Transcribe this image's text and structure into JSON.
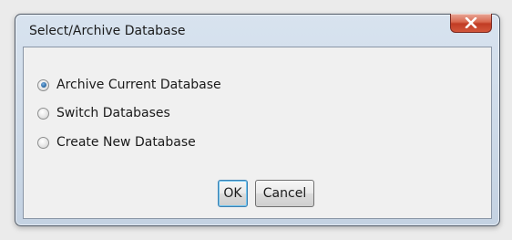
{
  "dialog": {
    "title": "Select/Archive Database",
    "close_icon": "close-x-icon",
    "options": [
      {
        "label": "Archive Current Database",
        "selected": true
      },
      {
        "label": "Switch Databases",
        "selected": false
      },
      {
        "label": "Create New Database",
        "selected": false
      }
    ],
    "ok_label": "OK",
    "cancel_label": "Cancel"
  }
}
